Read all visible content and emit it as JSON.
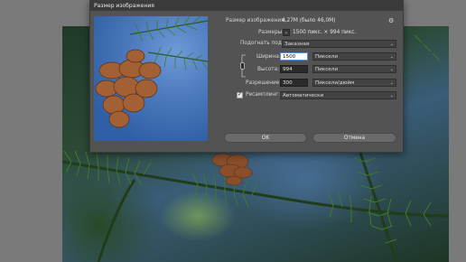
{
  "dialog": {
    "title": "Размер изображения",
    "image_size_label": "Размер изображения:",
    "image_size_value": "4,27M (было 46,0M)",
    "dimensions_label": "Размеры:",
    "dimensions_value": "1500 пикс.  ×  994 пикс.",
    "fit_to_label": "Подогнать под:",
    "fit_to_value": "Заказная",
    "width_label": "Ширина:",
    "width_value": "1500",
    "width_unit": "Пиксели",
    "height_label": "Высота:",
    "height_value": "994",
    "height_unit": "Пиксели",
    "resolution_label": "Разрешение:",
    "resolution_value": "300",
    "resolution_unit": "Пиксели/дюйм",
    "resample_label": "Ресамплинг:",
    "resample_value": "Автоматически",
    "resample_checked": true,
    "ok_label": "OK",
    "cancel_label": "Отмена"
  },
  "icons": {
    "gear": "gear-icon",
    "chain": "chain-link-icon",
    "dropdown": "chevron-down-icon"
  },
  "colors": {
    "dialog_bg": "#535353",
    "titlebar_bg": "#3b3b3b",
    "workspace_bg": "#7a7a7a",
    "active_input_border": "#5b8fd6"
  }
}
